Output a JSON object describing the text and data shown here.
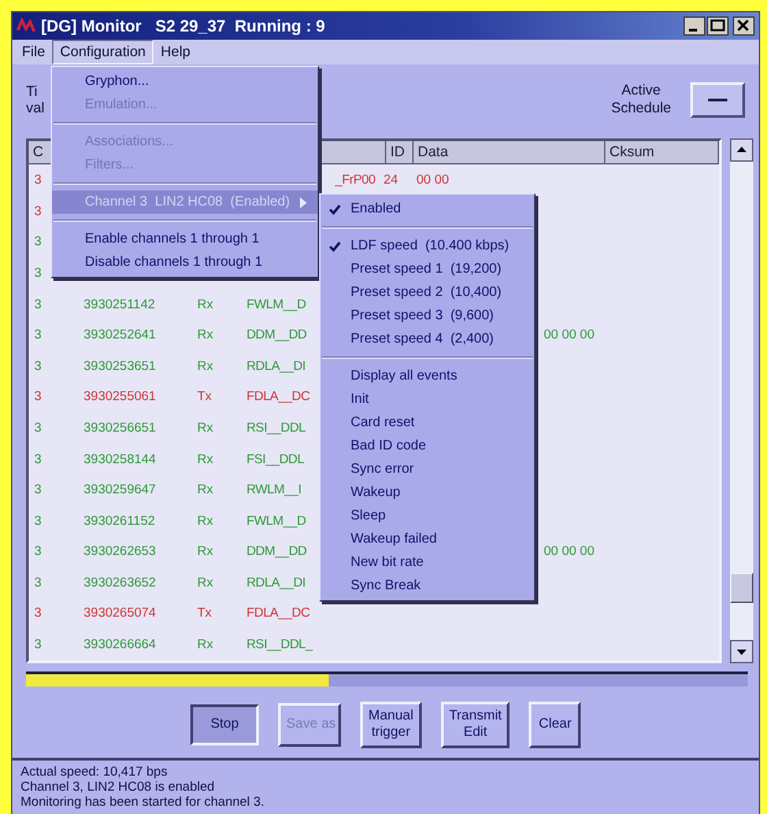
{
  "window": {
    "title": "[DG] Monitor   S2 29_37  Running : 9"
  },
  "menu_bar": [
    {
      "label": "File",
      "selected": false
    },
    {
      "label": "Configuration",
      "selected": true
    },
    {
      "label": "Help",
      "selected": false
    }
  ],
  "top_left_labels": [
    "Ti",
    "val"
  ],
  "active_schedule": {
    "label_lines": [
      "Active",
      "Schedule"
    ]
  },
  "table": {
    "columns": [
      "C",
      "ID",
      "Data",
      "Cksum"
    ],
    "rows": [
      {
        "color": "#d03434",
        "channel": "3",
        "name_tail": "_FrP00",
        "id": "24",
        "data": "00 00"
      },
      {
        "color": "#d03434",
        "channel": "3"
      },
      {
        "color": "#2e9a36",
        "channel": "3"
      },
      {
        "color": "#2e9a36",
        "channel": "3"
      },
      {
        "color": "#2e9a36",
        "channel": "3",
        "time": "3930251142",
        "dir": "Rx",
        "name": "FWLM__D"
      },
      {
        "color": "#2e9a36",
        "channel": "3",
        "time": "3930252641",
        "dir": "Rx",
        "name": "DDM__DD",
        "data_tail": "00 00 00"
      },
      {
        "color": "#2e9a36",
        "channel": "3",
        "time": "3930253651",
        "dir": "Rx",
        "name": "RDLA__DI"
      },
      {
        "color": "#d03434",
        "channel": "3",
        "time": "3930255061",
        "dir": "Tx",
        "name": "FDLA__DC"
      },
      {
        "color": "#2e9a36",
        "channel": "3",
        "time": "3930256651",
        "dir": "Rx",
        "name": "RSI__DDL"
      },
      {
        "color": "#2e9a36",
        "channel": "3",
        "time": "3930258144",
        "dir": "Rx",
        "name": "FSI__DDL"
      },
      {
        "color": "#2e9a36",
        "channel": "3",
        "time": "3930259647",
        "dir": "Rx",
        "name": "RWLM__I"
      },
      {
        "color": "#2e9a36",
        "channel": "3",
        "time": "3930261152",
        "dir": "Rx",
        "name": "FWLM__D"
      },
      {
        "color": "#2e9a36",
        "channel": "3",
        "time": "3930262653",
        "dir": "Rx",
        "name": "DDM__DD",
        "data_tail": "00 00 00"
      },
      {
        "color": "#2e9a36",
        "channel": "3",
        "time": "3930263652",
        "dir": "Rx",
        "name": "RDLA__DI"
      },
      {
        "color": "#d03434",
        "channel": "3",
        "time": "3930265074",
        "dir": "Tx",
        "name": "FDLA__DC"
      },
      {
        "color": "#2e9a36",
        "channel": "3",
        "time": "3930266664",
        "dir": "Rx",
        "name": "RSI__DDL_"
      }
    ]
  },
  "progress": {
    "level": 0.42
  },
  "buttons": [
    {
      "label": "Stop",
      "disabled": false,
      "pressed": true
    },
    {
      "label": "Save as",
      "disabled": true,
      "pressed": false
    },
    {
      "label": "Manual\ntrigger",
      "disabled": false,
      "pressed": false
    },
    {
      "label": "Transmit\nEdit",
      "disabled": false,
      "pressed": false
    },
    {
      "label": "Clear",
      "disabled": false,
      "pressed": false
    }
  ],
  "status_lines": [
    "Actual speed: 10,417 bps",
    "Channel 3, LIN2 HC08 is enabled",
    "Monitoring has been started for channel 3."
  ],
  "configuration_menu": [
    {
      "kind": "item",
      "label": "Gryphon...",
      "disabled": false,
      "selected": false
    },
    {
      "kind": "item",
      "label": "Emulation...",
      "disabled": true,
      "selected": false
    },
    {
      "kind": "separator"
    },
    {
      "kind": "item",
      "label": "Associations...",
      "disabled": true,
      "selected": false
    },
    {
      "kind": "item",
      "label": "Filters...",
      "disabled": true,
      "selected": false
    },
    {
      "kind": "separator"
    },
    {
      "kind": "submenu",
      "label": "Channel 3  LIN2 HC08  (Enabled)",
      "disabled": false,
      "selected": true
    },
    {
      "kind": "separator"
    },
    {
      "kind": "item",
      "label": "Enable channels 1 through 1",
      "disabled": false,
      "selected": false
    },
    {
      "kind": "item",
      "label": "Disable channels 1 through 1",
      "disabled": false,
      "selected": false
    }
  ],
  "channel_submenu": [
    {
      "kind": "item",
      "label": "Enabled",
      "checked": true
    },
    {
      "kind": "separator"
    },
    {
      "kind": "item",
      "label": "LDF speed  (10.400 kbps)",
      "checked": true
    },
    {
      "kind": "item",
      "label": "Preset speed 1  (19,200)",
      "checked": false
    },
    {
      "kind": "item",
      "label": "Preset speed 2  (10,400)",
      "checked": false
    },
    {
      "kind": "item",
      "label": "Preset speed 3  (9,600)",
      "checked": false
    },
    {
      "kind": "item",
      "label": "Preset speed 4  (2,400)",
      "checked": false
    },
    {
      "kind": "separator"
    },
    {
      "kind": "item",
      "label": "Display all events",
      "checked": false
    },
    {
      "kind": "item",
      "label": "Init",
      "checked": false
    },
    {
      "kind": "item",
      "label": "Card reset",
      "checked": false
    },
    {
      "kind": "item",
      "label": "Bad ID code",
      "checked": false
    },
    {
      "kind": "item",
      "label": "Sync error",
      "checked": false
    },
    {
      "kind": "item",
      "label": "Wakeup",
      "checked": false
    },
    {
      "kind": "item",
      "label": "Sleep",
      "checked": false
    },
    {
      "kind": "item",
      "label": "Wakeup failed",
      "checked": false
    },
    {
      "kind": "item",
      "label": "New bit rate",
      "checked": false
    },
    {
      "kind": "item",
      "label": "Sync Break",
      "checked": false
    }
  ]
}
